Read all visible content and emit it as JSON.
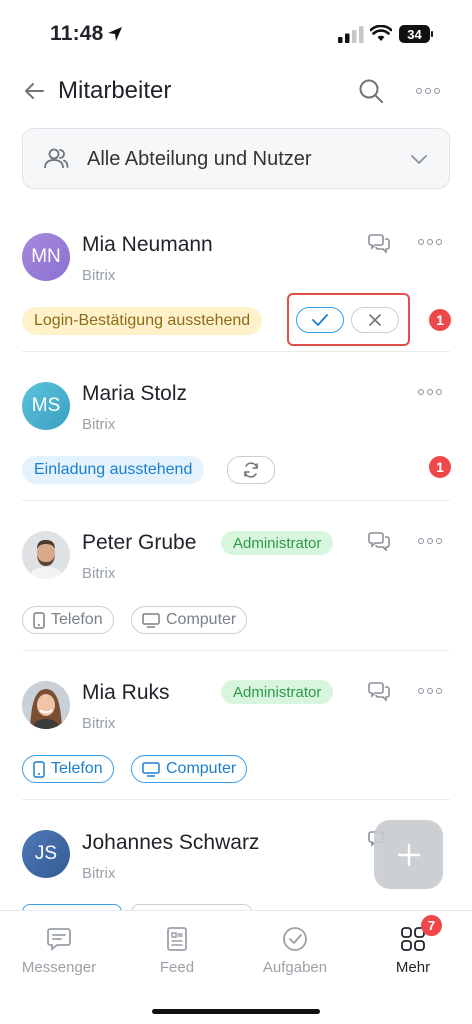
{
  "status_bar": {
    "time": "11:48",
    "battery": "34"
  },
  "header": {
    "title": "Mitarbeiter"
  },
  "filter": {
    "label": "Alle Abteilung und Nutzer"
  },
  "users": [
    {
      "initials": "MN",
      "name": "Mia Neumann",
      "company": "Bitrix",
      "status": "Login-Bestätigung ausstehend",
      "badge": "1"
    },
    {
      "initials": "MS",
      "name": "Maria Stolz",
      "company": "Bitrix",
      "status": "Einladung ausstehend",
      "badge": "1"
    },
    {
      "name": "Peter Grube",
      "company": "Bitrix",
      "role": "Administrator",
      "devices": [
        "Telefon",
        "Computer"
      ]
    },
    {
      "name": "Mia Ruks",
      "company": "Bitrix",
      "role": "Administrator",
      "devices": [
        "Telefon",
        "Computer"
      ]
    },
    {
      "initials": "JS",
      "name": "Johannes Schwarz",
      "company": "Bitrix"
    }
  ],
  "tabs": [
    {
      "label": "Messenger"
    },
    {
      "label": "Feed"
    },
    {
      "label": "Aufgaben"
    },
    {
      "label": "Mehr",
      "badge": "7"
    }
  ],
  "colors": {
    "accent": "#1a7fcf",
    "badge": "#f0484a",
    "highlight": "#e0504a"
  }
}
